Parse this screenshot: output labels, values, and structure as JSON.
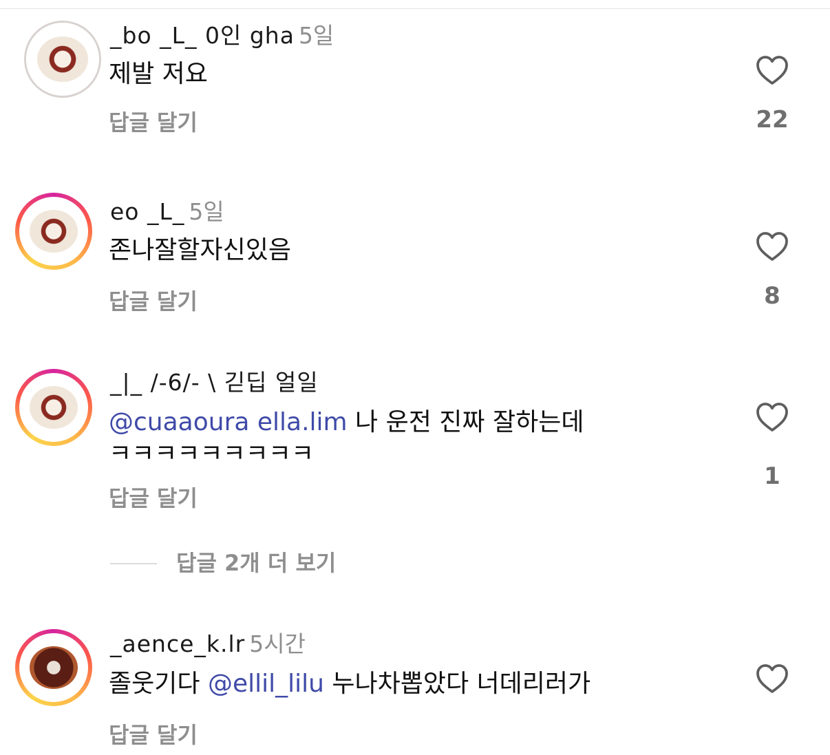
{
  "comments": [
    {
      "username": "_bo  _L_ 0인  gha",
      "time": "5일",
      "text": "제발 저요",
      "reply_label": "답글 달기",
      "like_count": "22"
    },
    {
      "username": "eo  _L_",
      "time": "5일",
      "text": "존나잘할자신있음",
      "reply_label": "답글 달기",
      "like_count": "8"
    },
    {
      "username": "_|_ /-6/-   \\ 긷딥 얼일",
      "time": "",
      "mention": "@cuaaoura     ella.lim",
      "text": " 나 운전 진짜 잘하는데",
      "text_line2": "ㅋㅋㅋㅋㅋㅋㅋㅋㅋ",
      "reply_label": "답글 달기",
      "like_count": "1",
      "more_replies": "답글 2개 더 보기"
    },
    {
      "username": "_aence_k.lr",
      "time": "5시간",
      "text_before": "졸웃기다 ",
      "mention": "@ellil_lilu",
      "text_after": " 누나차뽑았다 너데리러가",
      "reply_label": "답글 달기",
      "like_count": ""
    }
  ],
  "icons": {
    "like": "heart-outline-icon"
  }
}
